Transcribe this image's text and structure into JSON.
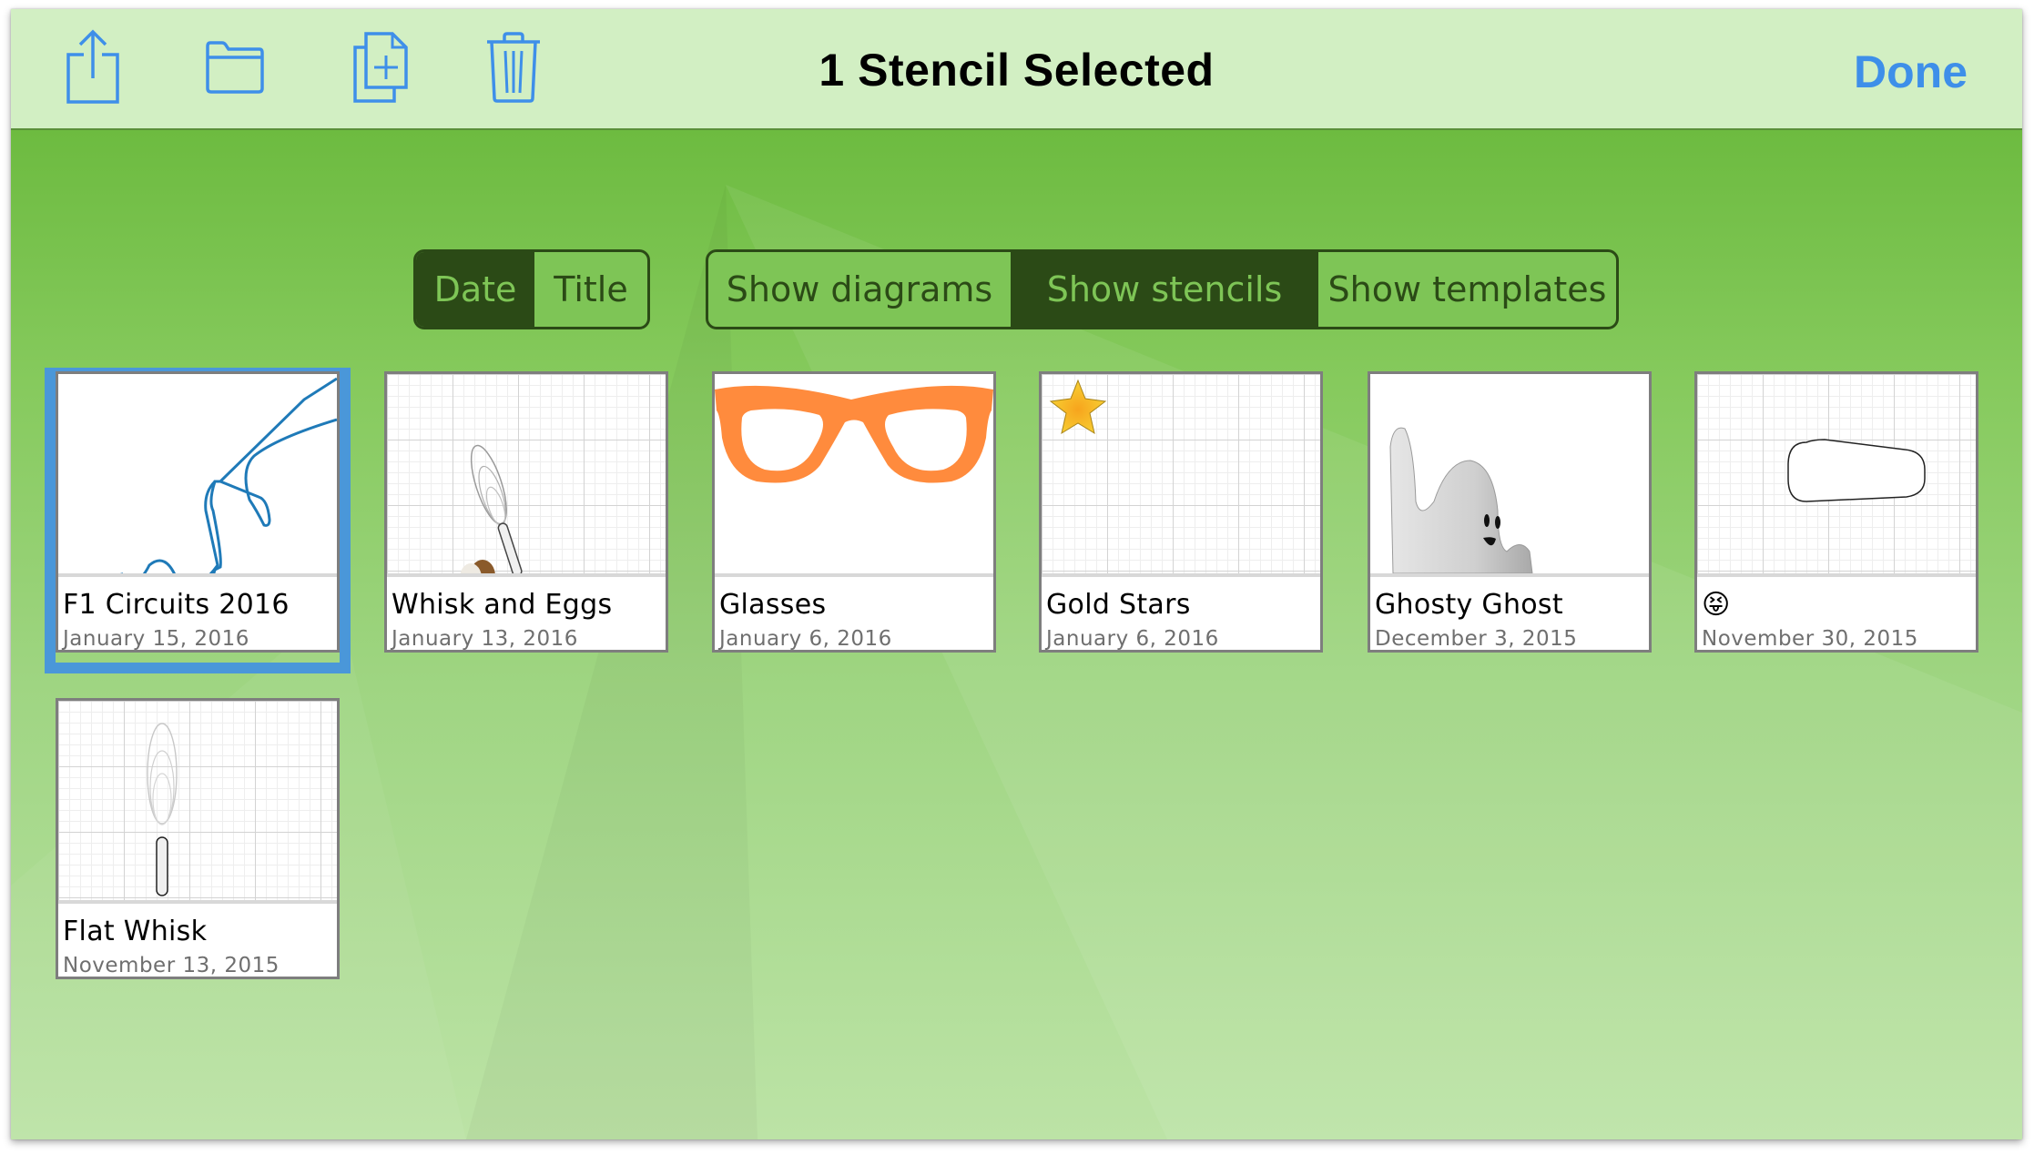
{
  "toolbar": {
    "title": "1 Stencil Selected",
    "done_label": "Done",
    "icons": [
      "share-icon",
      "folder-icon",
      "duplicate-icon",
      "trash-icon"
    ],
    "accent_color": "#3e8fe9"
  },
  "sort_control": {
    "options": [
      "Date",
      "Title"
    ],
    "selected": "Date"
  },
  "filter_control": {
    "options": [
      "Show diagrams",
      "Show stencils",
      "Show templates"
    ],
    "selected": "Show stencils"
  },
  "documents": [
    {
      "name": "F1 Circuits 2016",
      "date": "January 15, 2016",
      "selected": true,
      "thumbnail": "race-circuit"
    },
    {
      "name": "Whisk and Eggs",
      "date": "January 13, 2016",
      "selected": false,
      "thumbnail": "whisk-eggs"
    },
    {
      "name": "Glasses",
      "date": "January 6, 2016",
      "selected": false,
      "thumbnail": "orange-glasses"
    },
    {
      "name": "Gold Stars",
      "date": "January 6, 2016",
      "selected": false,
      "thumbnail": "gold-star"
    },
    {
      "name": "Ghosty Ghost",
      "date": "December 3, 2015",
      "selected": false,
      "thumbnail": "ghost"
    },
    {
      "name": "😝",
      "date": "November 30, 2015",
      "selected": false,
      "thumbnail": "rounded-shape"
    },
    {
      "name": "Flat Whisk",
      "date": "November 13, 2015",
      "selected": false,
      "thumbnail": "flat-whisk"
    }
  ],
  "colors": {
    "header_bg": "#d2efc3",
    "segment_dark": "#2b4a16",
    "segment_light": "#7ec556",
    "selection": "#4a97d9"
  }
}
